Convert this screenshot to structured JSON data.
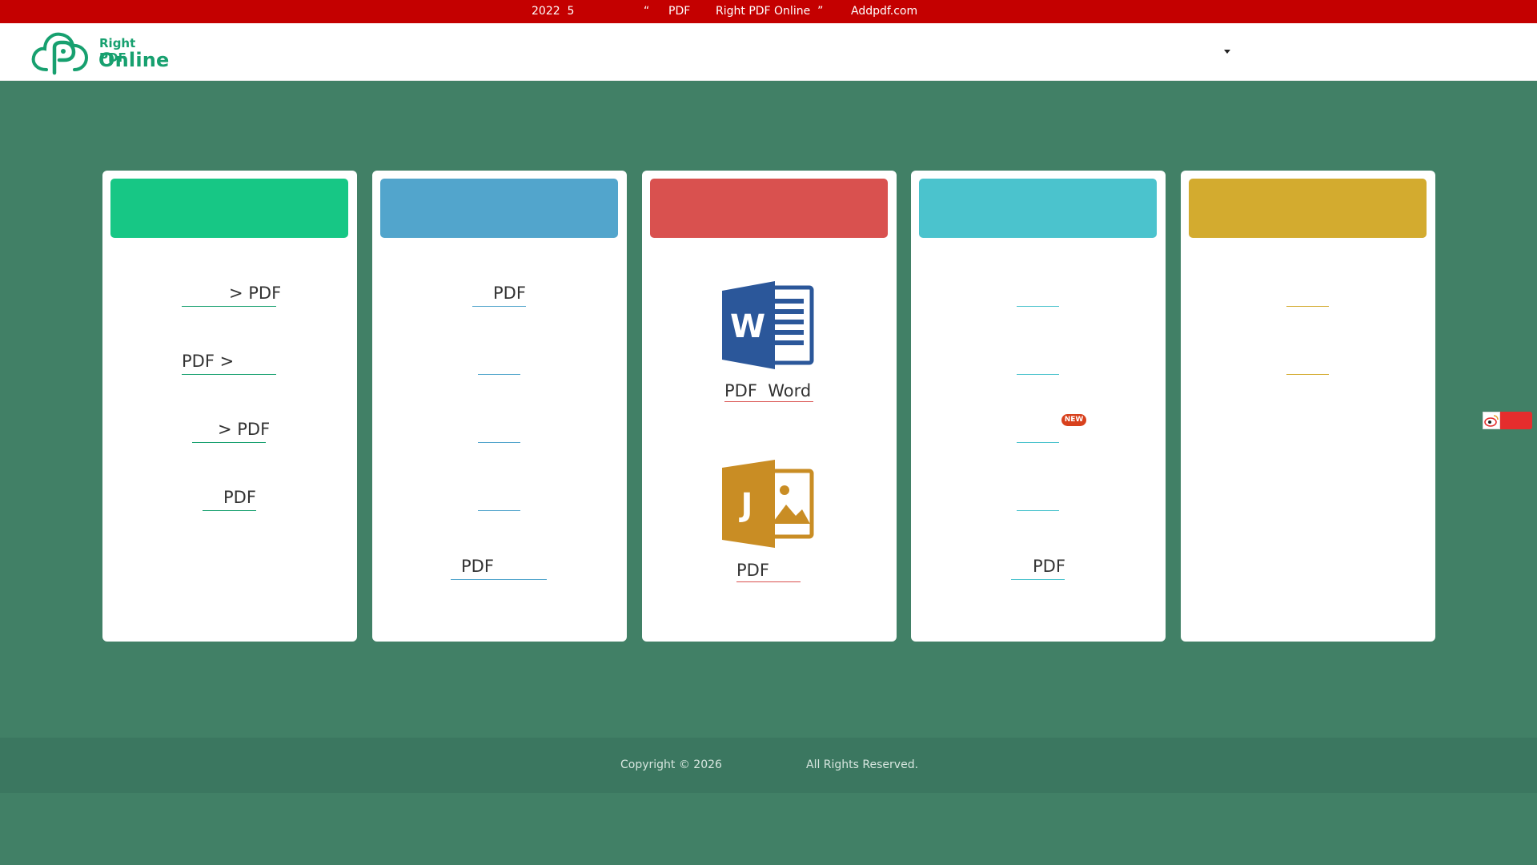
{
  "announcement": {
    "part1": "2022  5",
    "part2": "“",
    "part3": "PDF",
    "part4": "Right PDF Online  ”",
    "part5": "Addpdf.com"
  },
  "logo": {
    "line1": "Right PDF",
    "line2": "Online"
  },
  "colors": {
    "brand": "#17a06f",
    "background": "#418066",
    "announce_bar": "#c40000",
    "card1_head": "#17c785",
    "card2_head": "#52a5cc",
    "card3_head": "#d9514f",
    "card4_head": "#4bc3cd",
    "card5_head": "#d3ab2f"
  },
  "cards": [
    {
      "links": [
        "> PDF",
        "PDF >",
        "> PDF",
        "PDF"
      ]
    },
    {
      "links": [
        "PDF",
        "",
        "",
        "",
        "PDF"
      ]
    },
    {
      "links": [
        "PDF  Word",
        "PDF"
      ]
    },
    {
      "links": [
        "",
        "",
        "",
        "",
        "PDF"
      ],
      "badge": "NEW"
    },
    {
      "links": [
        "",
        ""
      ]
    }
  ],
  "icons": {
    "word": "word-document-icon",
    "jpg": "jpg-image-icon",
    "weibo": "weibo-icon"
  },
  "footer": {
    "copyright": "Copyright © 2026",
    "rights": "All Rights Reserved."
  }
}
